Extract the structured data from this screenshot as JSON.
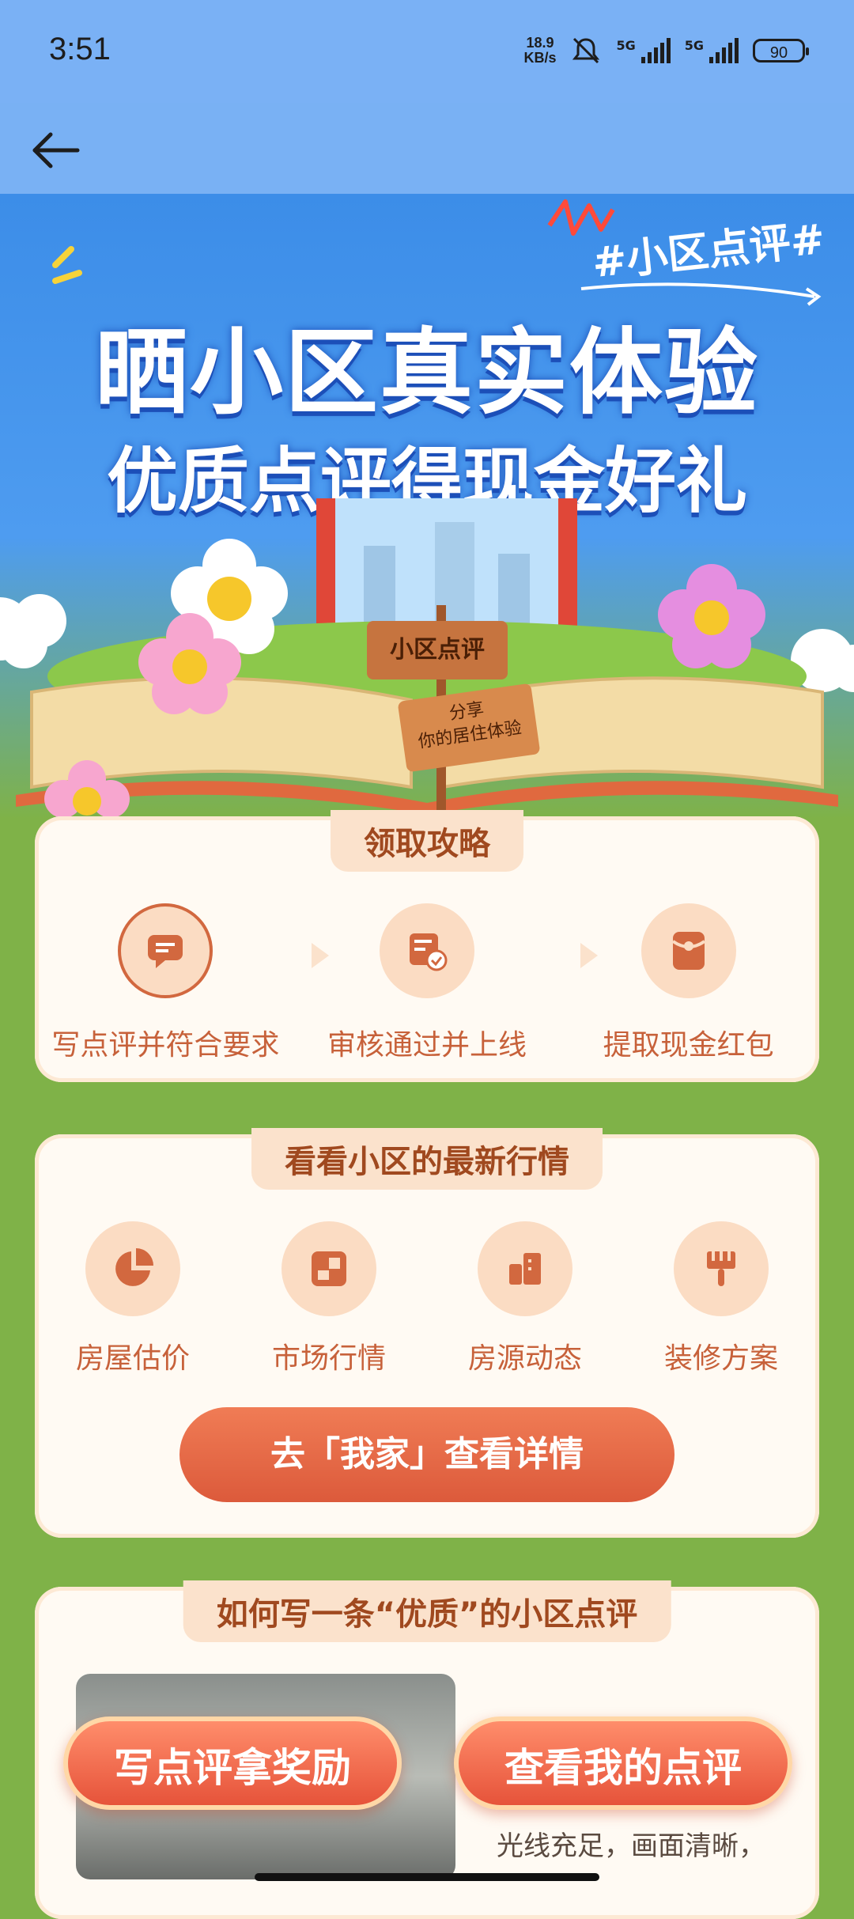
{
  "status_bar": {
    "time": "3:51",
    "net_speed_value": "18.9",
    "net_speed_unit": "KB/s",
    "sig1_label": "5G",
    "sig2_label": "5G",
    "battery": "90"
  },
  "hero": {
    "hashtag": "#小区点评#",
    "title_line1": "晒小区真实体验",
    "title_line2": "优质点评得现金好礼",
    "sign_main": "小区点评",
    "sign_sub_line1": "分享",
    "sign_sub_line2": "你的居住体验"
  },
  "guide": {
    "tab": "领取攻略",
    "steps": [
      {
        "label": "写点评并符合要求"
      },
      {
        "label": "审核通过并上线"
      },
      {
        "label": "提取现金红包"
      }
    ]
  },
  "market": {
    "tab": "看看小区的最新行情",
    "items": [
      {
        "label": "房屋估价"
      },
      {
        "label": "市场行情"
      },
      {
        "label": "房源动态"
      },
      {
        "label": "装修方案"
      }
    ],
    "cta": "去「我家」查看详情"
  },
  "howto": {
    "tab": "如何写一条“优质”的小区点评",
    "photo_desc": "光线充足，画面清晰，"
  },
  "bottom": {
    "write_btn": "写点评拿奖励",
    "view_btn": "查看我的点评"
  },
  "colors": {
    "accent": "#dc5a3b",
    "text_orange": "#c7613a",
    "card_bg": "#fffaf3",
    "grass": "#7fb248",
    "sky": "#4e9cf0"
  }
}
